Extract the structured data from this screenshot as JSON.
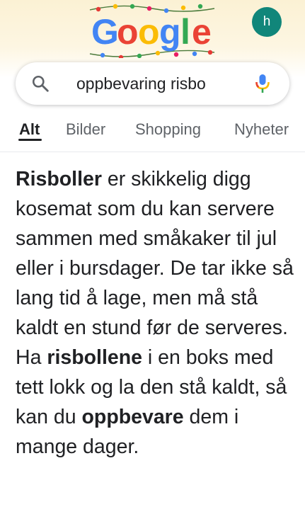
{
  "header": {
    "logo_text": "Google",
    "avatar_letter": "h"
  },
  "search": {
    "query": "oppbevaring risbo"
  },
  "tabs": [
    {
      "label": "Alt",
      "active": true
    },
    {
      "label": "Bilder",
      "active": false
    },
    {
      "label": "Shopping",
      "active": false
    },
    {
      "label": "Nyheter",
      "active": false
    }
  ],
  "snippet": {
    "segments": [
      {
        "text": "Risboller",
        "bold": true
      },
      {
        "text": " er skikkelig digg kosemat som du kan servere sammen med småkaker til jul eller i bursdager. De tar ikke så lang tid å lage, men må stå kaldt en stund før de serveres. Ha ",
        "bold": false
      },
      {
        "text": "risbollene",
        "bold": true
      },
      {
        "text": " i en boks med tett lokk og la den stå kaldt, så kan du ",
        "bold": false
      },
      {
        "text": "oppbevare",
        "bold": true
      },
      {
        "text": " dem i mange dager.",
        "bold": false
      }
    ]
  },
  "colors": {
    "avatar_bg": "#11867a",
    "header_bg": "#fbf1d4",
    "text": "#202124",
    "tab_inactive": "#5f6368"
  },
  "icons": {
    "search": "search-icon",
    "mic": "microphone-icon"
  }
}
